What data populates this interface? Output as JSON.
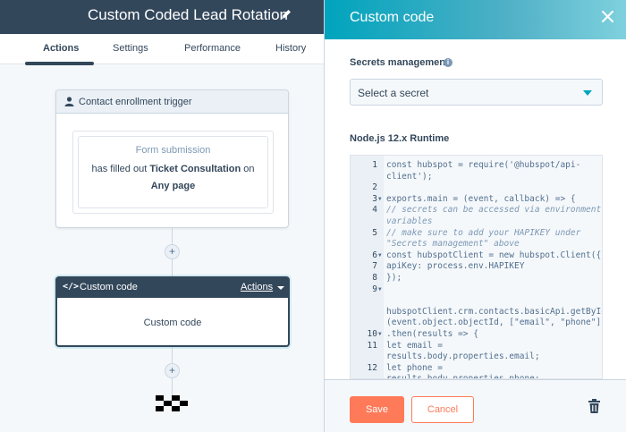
{
  "workflow": {
    "title": "Custom Coded Lead Rotation",
    "tabs": [
      "Actions",
      "Settings",
      "Performance",
      "History"
    ],
    "active_tab": "Actions",
    "trigger": {
      "header": "Contact enrollment trigger",
      "source": "Form submission",
      "filled_prefix": "has filled out ",
      "form_name": "Ticket Consultation",
      "filled_suffix": " on",
      "page": "Any page"
    },
    "action_card": {
      "header": "Custom code",
      "actions_label": "Actions",
      "body": "Custom code"
    },
    "icons": [
      "pencil-icon",
      "person-icon",
      "code-tag-icon",
      "plus-icon",
      "checkered-flag-icon"
    ]
  },
  "panel": {
    "title": "Custom code",
    "secrets_label": "Secrets management",
    "secret_placeholder": "Select a secret",
    "runtime_label": "Node.js 12.x Runtime",
    "code_lines": [
      {
        "num": "1",
        "fold": "",
        "text": "const hubspot = require('@hubspot/api-",
        "kind": "plain"
      },
      {
        "num": "",
        "fold": "",
        "text": "client');",
        "kind": "plain"
      },
      {
        "num": "2",
        "fold": "",
        "text": "",
        "kind": "plain"
      },
      {
        "num": "3",
        "fold": "▼",
        "text": "exports.main = (event, callback) => {",
        "kind": "plain"
      },
      {
        "num": "4",
        "fold": "",
        "text": "  // secrets can be accessed via environment",
        "kind": "comment"
      },
      {
        "num": "",
        "fold": "",
        "text": "variables",
        "kind": "comment"
      },
      {
        "num": "5",
        "fold": "",
        "text": "  // make sure to add your HAPIKEY under",
        "kind": "comment"
      },
      {
        "num": "",
        "fold": "",
        "text": "\"Secrets management\" above",
        "kind": "comment"
      },
      {
        "num": "6",
        "fold": "▼",
        "text": "  const hubspotClient = new hubspot.Client({",
        "kind": "plain"
      },
      {
        "num": "7",
        "fold": "",
        "text": "    apiKey: process.env.HAPIKEY",
        "kind": "plain"
      },
      {
        "num": "8",
        "fold": "",
        "text": "  });",
        "kind": "plain"
      },
      {
        "num": "9",
        "fold": "▼",
        "text": "",
        "kind": "plain"
      },
      {
        "num": "",
        "fold": "",
        "text": "",
        "kind": "plain"
      },
      {
        "num": "",
        "fold": "",
        "text": " hubspotClient.crm.contacts.basicApi.getById",
        "kind": "plain"
      },
      {
        "num": "",
        "fold": "",
        "text": "(event.object.objectId, [\"email\", \"phone\"])",
        "kind": "plain"
      },
      {
        "num": "10",
        "fold": "▼",
        "text": "    .then(results => {",
        "kind": "plain"
      },
      {
        "num": "11",
        "fold": "",
        "text": "      let email =",
        "kind": "plain"
      },
      {
        "num": "",
        "fold": "",
        "text": "results.body.properties.email;",
        "kind": "plain"
      },
      {
        "num": "12",
        "fold": "",
        "text": "      let phone =",
        "kind": "plain"
      },
      {
        "num": "",
        "fold": "",
        "text": "results.body.properties.phone;",
        "kind": "plain"
      }
    ],
    "save_label": "Save",
    "cancel_label": "Cancel",
    "icons": [
      "close-icon",
      "info-icon",
      "chevron-down-icon",
      "trash-icon"
    ]
  },
  "colors": {
    "header_dark": "#33475b",
    "panel_accent": "#00a4bd",
    "save_orange": "#ff7a59"
  }
}
